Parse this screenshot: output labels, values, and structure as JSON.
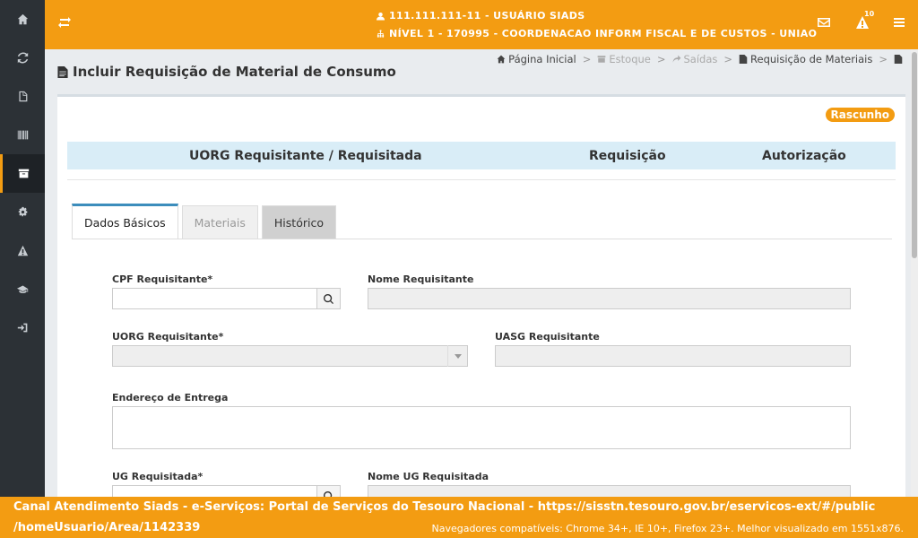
{
  "topbar": {
    "user_line": "111.111.111-11 - USUÁRIO SIADS",
    "org_line": "NÍVEL 1 - 170995 - COORDENACAO INFORM FISCAL E DE CUSTOS - UNIAO",
    "alerts_count": "10"
  },
  "sidebar": {
    "items": [
      {
        "icon": "home-icon"
      },
      {
        "icon": "refresh-icon"
      },
      {
        "icon": "document-money-icon"
      },
      {
        "icon": "barcode-icon"
      },
      {
        "icon": "archive-icon"
      },
      {
        "icon": "gears-icon"
      },
      {
        "icon": "warning-icon"
      },
      {
        "icon": "graduation-cap-icon"
      },
      {
        "icon": "sign-out-icon"
      }
    ]
  },
  "page": {
    "title": "Incluir Requisição de Material de Consumo"
  },
  "breadcrumb": {
    "home": "Página Inicial",
    "estoque": "Estoque",
    "saidas": "Saídas",
    "requisicao": "Requisição de Materiais"
  },
  "status_badge": "Rascunho",
  "header_bar": {
    "uorg": "UORG Requisitante / Requisitada",
    "requisicao": "Requisição",
    "autorizacao": "Autorização"
  },
  "tabs": [
    {
      "label": "Dados Básicos"
    },
    {
      "label": "Materiais"
    },
    {
      "label": "Histórico"
    }
  ],
  "form": {
    "cpf_label": "CPF Requisitante*",
    "cpf_value": "",
    "nome_requisitante_label": "Nome Requisitante",
    "uorg_requisitante_label": "UORG Requisitante*",
    "uasg_label": "UASG Requisitante",
    "endereco_label": "Endereço de Entrega",
    "ug_label": "UG Requisitada*",
    "nome_ug_label": "Nome UG Requisitada"
  },
  "footer": {
    "line1": "Canal Atendimento Siads - e-Serviços: Portal de Serviços do Tesouro Nacional - https://sisstn.tesouro.gov.br/eservicos-ext/#/public",
    "line2": "/homeUsuario/Area/1142339",
    "compat": "Navegadores compatíveis: Chrome 34+, IE 10+, Firefox 23+. Melhor visualizado em 1551x876."
  },
  "colors": {
    "accent": "#f39c12",
    "sidebar": "#2c3136",
    "info_bar": "#d9edf7",
    "tab_active_border": "#3c8dbc"
  }
}
